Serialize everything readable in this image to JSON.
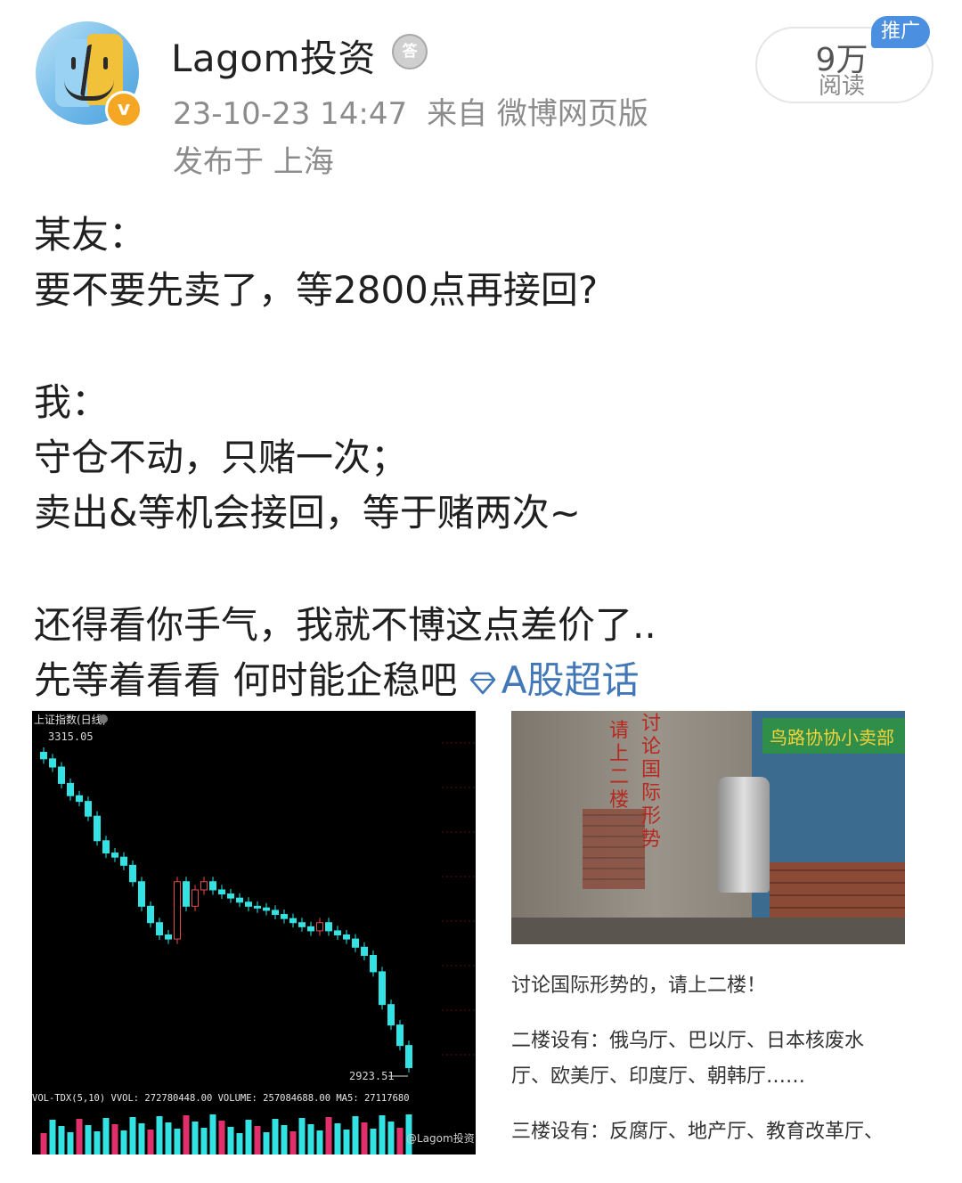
{
  "header": {
    "username": "Lagom投资",
    "medal_icon": "medal-icon",
    "verified_icon": "verified-badge-icon",
    "timestamp": "23-10-23 14:47",
    "source": "来自 微博网页版",
    "location": "发布于 上海",
    "reads_count": "9万",
    "reads_label": "阅读",
    "promo_tag": "推广"
  },
  "post": {
    "lines": [
      "某友：",
      "要不要先卖了，等2800点再接回?",
      "我：",
      "守仓不动，只赌一次；",
      "卖出&等机会接回，等于赌两次~",
      "还得看你手气，我就不博这点差价了..",
      "先等着看看 何时能企稳吧"
    ],
    "topic_link": "A股超话",
    "topic_icon": "super-topic-diamond-icon"
  },
  "chart_image": {
    "title": "上证指数(日线)",
    "high_label": "3315.05",
    "low_label": "2923.51",
    "indicator_text": "VOL-TDX(5,10)  VVOL: 272780448.00  VOLUME: 257084688.00  MA5: 27117680",
    "watermark": "@Lagom投资",
    "chart_data": {
      "type": "candlestick",
      "y_high_marked": 3315.05,
      "y_low_marked": 2923.51,
      "closes_trend": [
        3300,
        3290,
        3270,
        3255,
        3248,
        3230,
        3200,
        3185,
        3180,
        3170,
        3150,
        3120,
        3100,
        3085,
        3080,
        3150,
        3120,
        3140,
        3150,
        3140,
        3135,
        3130,
        3125,
        3120,
        3118,
        3115,
        3110,
        3105,
        3100,
        3095,
        3090,
        3100,
        3090,
        3085,
        3080,
        3070,
        3060,
        3040,
        3000,
        2975,
        2950,
        2923
      ]
    }
  },
  "photo_image": {
    "vertical_text_1": "请上二楼",
    "vertical_text_2": "讨论国际形势",
    "shop_sign": "鸟路协协小卖部"
  },
  "captions": [
    "讨论国际形势的，请上二楼！",
    "二楼设有：俄乌厅、巴以厅、日本核废水",
    "厅、欧美厅、印度厅、朝韩厅……",
    "三楼设有：反腐厅、地产厅、教育改革厅、"
  ]
}
